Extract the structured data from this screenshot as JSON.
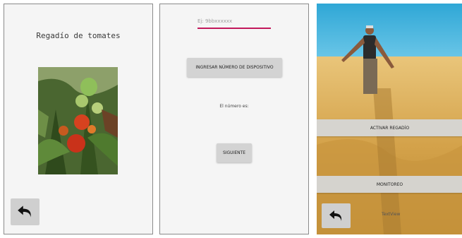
{
  "screen1": {
    "title": "Regadío de tomates",
    "photo": "tomato-plant-photo",
    "back_icon": "undo-arrow-icon"
  },
  "screen2": {
    "input_placeholder": "Ej: 9bbxxxxxx",
    "ingresar_label": "INGRESAR NÚMERO DE DISPOSITIVO",
    "numero_label": "El número es:",
    "siguiente_label": "SIGUIENTE"
  },
  "screen3": {
    "background": "wheat-field-farmer-photo",
    "activar_label": "ACTIVAR REGADÍO",
    "monitoreo_label": "MONITOREO",
    "textview_label": "TextView",
    "back_icon": "undo-arrow-icon"
  },
  "colors": {
    "input_underline": "#c2185b",
    "button_gray": "#d3d3d3",
    "screen_bg": "#f5f5f5"
  }
}
